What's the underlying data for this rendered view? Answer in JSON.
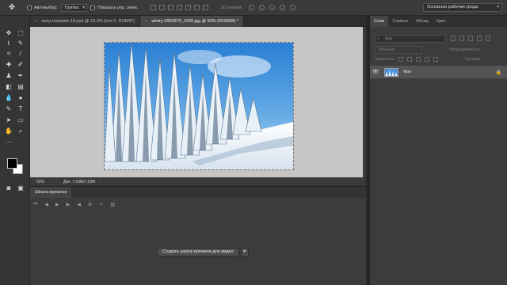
{
  "options": {
    "autoselect_label": "Автовыбор:",
    "autoselect_value": "Группа",
    "show_controls_label": "Показать упр. элем.",
    "mode3d_label": "3D-режим:",
    "workspace": "Основная рабочая среда"
  },
  "tabs": [
    {
      "label": "story-template-18.psd @ 33,3% (text 1, RGB/8*)"
    },
    {
      "label": "wintry-2993370_1920.jpg @ 50% (RGB/8#) *"
    }
  ],
  "status": {
    "zoom": "50%",
    "doc_size": "Док: 7,03M/7,03M"
  },
  "timeline": {
    "tab_label": "Шкала времени",
    "create_button": "Создать шкалу времени для видео"
  },
  "layers_panel": {
    "tabs": [
      "Слои",
      "Символ",
      "Абзац",
      "Цвет"
    ],
    "filter_placeholder": "Вид",
    "blend_mode": "Обычные",
    "opacity_label": "Непрозрачность:",
    "lock_label": "Закрепить:",
    "fill_label": "Заливка:",
    "layers": [
      {
        "name": "Фон",
        "locked": true
      }
    ]
  },
  "colors": {
    "foreground": "#000000",
    "background": "#ffffff",
    "accent_sky": "#3b8ed8"
  }
}
